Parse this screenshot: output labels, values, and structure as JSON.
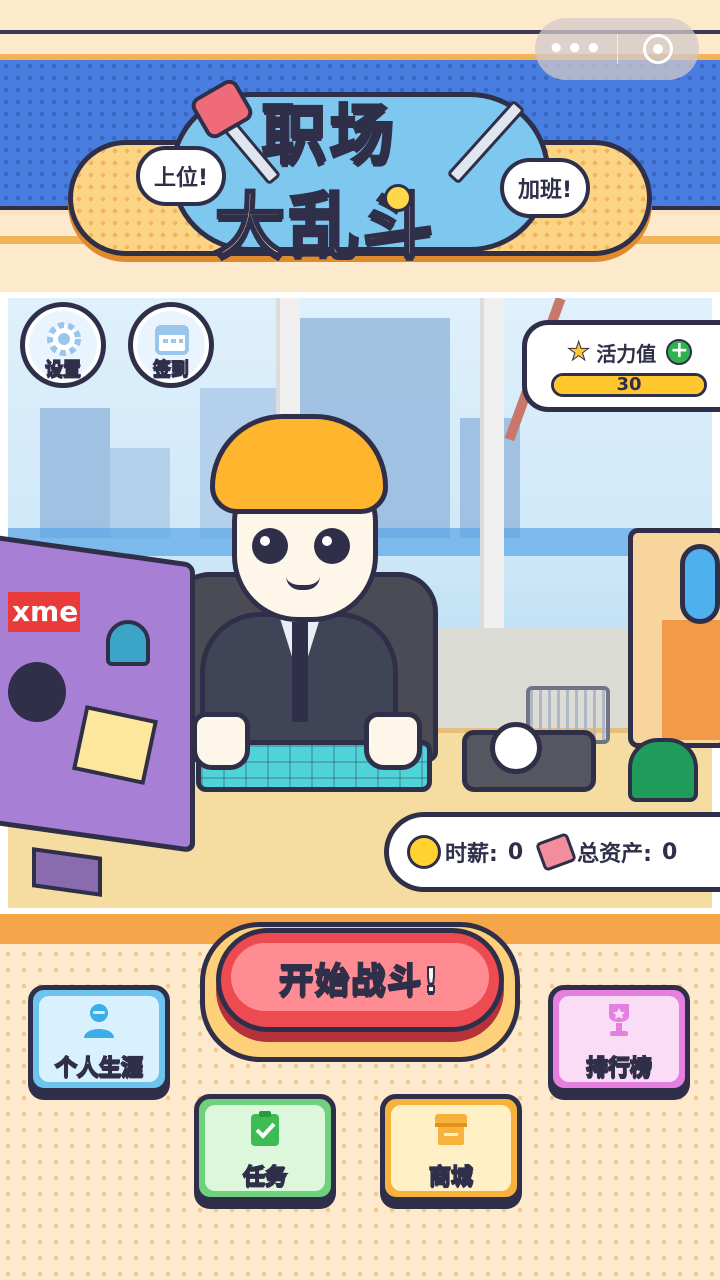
{
  "system_capsule": {
    "more_icon": "more-dots-icon",
    "close_icon": "close-circle-icon"
  },
  "header": {
    "title_line1": "职场",
    "title_line2": "大乱斗",
    "bubble_left": "上位!",
    "bubble_right": "加班!"
  },
  "scene": {
    "settings": {
      "label": "设置",
      "icon": "gear-icon"
    },
    "checkin": {
      "label": "签到",
      "icon": "calendar-icon"
    },
    "energy": {
      "label": "活力值",
      "value": "30",
      "fill_fraction": 1.0,
      "icon": "star-icon",
      "add_icon": "plus-icon"
    },
    "monitor_label": "xme",
    "salary_label": "时薪:",
    "salary_value": "0",
    "assets_label": "总资产:",
    "assets_value": "0"
  },
  "actions": {
    "start": "开始战斗!",
    "career": {
      "label": "个人生涯",
      "icon": "person-icon"
    },
    "rank": {
      "label": "排行榜",
      "icon": "trophy-icon"
    },
    "task": {
      "label": "任务",
      "icon": "clipboard-check-icon"
    },
    "shop": {
      "label": "商城",
      "icon": "shop-icon"
    }
  },
  "colors": {
    "outline": "#2f2f4a",
    "banner_blue": "#4a7de0",
    "start_red": "#ee4a52",
    "energy_yellow": "#ffc62e"
  }
}
